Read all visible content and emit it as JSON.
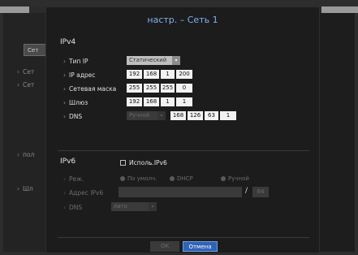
{
  "background": {
    "tab_label": "Сет",
    "items": [
      "Сет",
      "Сет",
      "пол",
      "Шл"
    ]
  },
  "dialog": {
    "title": "настр.  – Сеть 1",
    "ipv4": {
      "heading": "IPv4",
      "ip_type_label": "Тип IP",
      "ip_type_value": "Статический",
      "ip_label": "IP адрес",
      "ip_value": [
        "192",
        "168",
        "1",
        "200"
      ],
      "mask_label": "Сетевая маска",
      "mask_value": [
        "255",
        "255",
        "255",
        "0"
      ],
      "gateway_label": "Шлюз",
      "gateway_value": [
        "192",
        "168",
        "1",
        "1"
      ],
      "dns_label": "DNS",
      "dns_mode": "Ручной",
      "dns_value": [
        "168",
        "126",
        "63",
        "1"
      ]
    },
    "ipv6": {
      "heading": "IPv6",
      "use_label": "Исполь.IPv6",
      "use_checked": false,
      "mode_label": "Реж.",
      "mode_options": [
        "По умолч.",
        "DHCP",
        "Ручной"
      ],
      "address_label": "Адрес IPv6",
      "address_value": "",
      "prefix_value": "64",
      "dns_label": "DNS",
      "dns_value": "Авто"
    },
    "buttons": {
      "ok": "OK",
      "cancel": "Отмена"
    }
  },
  "colors": {
    "title": "#7fb0f0",
    "cancel_button": "#2f63b6",
    "dialog_bg": "#1c1c1c"
  }
}
